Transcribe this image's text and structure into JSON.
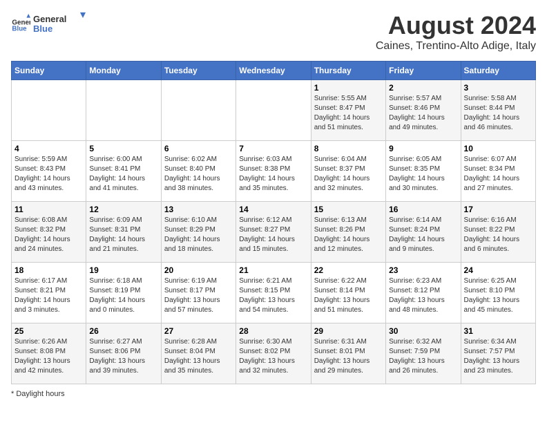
{
  "header": {
    "title": "August 2024",
    "subtitle": "Caines, Trentino-Alto Adige, Italy",
    "logo_line1": "General",
    "logo_line2": "Blue"
  },
  "days_of_week": [
    "Sunday",
    "Monday",
    "Tuesday",
    "Wednesday",
    "Thursday",
    "Friday",
    "Saturday"
  ],
  "weeks": [
    [
      {
        "day": "",
        "info": ""
      },
      {
        "day": "",
        "info": ""
      },
      {
        "day": "",
        "info": ""
      },
      {
        "day": "",
        "info": ""
      },
      {
        "day": "1",
        "info": "Sunrise: 5:55 AM\nSunset: 8:47 PM\nDaylight: 14 hours and 51 minutes."
      },
      {
        "day": "2",
        "info": "Sunrise: 5:57 AM\nSunset: 8:46 PM\nDaylight: 14 hours and 49 minutes."
      },
      {
        "day": "3",
        "info": "Sunrise: 5:58 AM\nSunset: 8:44 PM\nDaylight: 14 hours and 46 minutes."
      }
    ],
    [
      {
        "day": "4",
        "info": "Sunrise: 5:59 AM\nSunset: 8:43 PM\nDaylight: 14 hours and 43 minutes."
      },
      {
        "day": "5",
        "info": "Sunrise: 6:00 AM\nSunset: 8:41 PM\nDaylight: 14 hours and 41 minutes."
      },
      {
        "day": "6",
        "info": "Sunrise: 6:02 AM\nSunset: 8:40 PM\nDaylight: 14 hours and 38 minutes."
      },
      {
        "day": "7",
        "info": "Sunrise: 6:03 AM\nSunset: 8:38 PM\nDaylight: 14 hours and 35 minutes."
      },
      {
        "day": "8",
        "info": "Sunrise: 6:04 AM\nSunset: 8:37 PM\nDaylight: 14 hours and 32 minutes."
      },
      {
        "day": "9",
        "info": "Sunrise: 6:05 AM\nSunset: 8:35 PM\nDaylight: 14 hours and 30 minutes."
      },
      {
        "day": "10",
        "info": "Sunrise: 6:07 AM\nSunset: 8:34 PM\nDaylight: 14 hours and 27 minutes."
      }
    ],
    [
      {
        "day": "11",
        "info": "Sunrise: 6:08 AM\nSunset: 8:32 PM\nDaylight: 14 hours and 24 minutes."
      },
      {
        "day": "12",
        "info": "Sunrise: 6:09 AM\nSunset: 8:31 PM\nDaylight: 14 hours and 21 minutes."
      },
      {
        "day": "13",
        "info": "Sunrise: 6:10 AM\nSunset: 8:29 PM\nDaylight: 14 hours and 18 minutes."
      },
      {
        "day": "14",
        "info": "Sunrise: 6:12 AM\nSunset: 8:27 PM\nDaylight: 14 hours and 15 minutes."
      },
      {
        "day": "15",
        "info": "Sunrise: 6:13 AM\nSunset: 8:26 PM\nDaylight: 14 hours and 12 minutes."
      },
      {
        "day": "16",
        "info": "Sunrise: 6:14 AM\nSunset: 8:24 PM\nDaylight: 14 hours and 9 minutes."
      },
      {
        "day": "17",
        "info": "Sunrise: 6:16 AM\nSunset: 8:22 PM\nDaylight: 14 hours and 6 minutes."
      }
    ],
    [
      {
        "day": "18",
        "info": "Sunrise: 6:17 AM\nSunset: 8:21 PM\nDaylight: 14 hours and 3 minutes."
      },
      {
        "day": "19",
        "info": "Sunrise: 6:18 AM\nSunset: 8:19 PM\nDaylight: 14 hours and 0 minutes."
      },
      {
        "day": "20",
        "info": "Sunrise: 6:19 AM\nSunset: 8:17 PM\nDaylight: 13 hours and 57 minutes."
      },
      {
        "day": "21",
        "info": "Sunrise: 6:21 AM\nSunset: 8:15 PM\nDaylight: 13 hours and 54 minutes."
      },
      {
        "day": "22",
        "info": "Sunrise: 6:22 AM\nSunset: 8:14 PM\nDaylight: 13 hours and 51 minutes."
      },
      {
        "day": "23",
        "info": "Sunrise: 6:23 AM\nSunset: 8:12 PM\nDaylight: 13 hours and 48 minutes."
      },
      {
        "day": "24",
        "info": "Sunrise: 6:25 AM\nSunset: 8:10 PM\nDaylight: 13 hours and 45 minutes."
      }
    ],
    [
      {
        "day": "25",
        "info": "Sunrise: 6:26 AM\nSunset: 8:08 PM\nDaylight: 13 hours and 42 minutes."
      },
      {
        "day": "26",
        "info": "Sunrise: 6:27 AM\nSunset: 8:06 PM\nDaylight: 13 hours and 39 minutes."
      },
      {
        "day": "27",
        "info": "Sunrise: 6:28 AM\nSunset: 8:04 PM\nDaylight: 13 hours and 35 minutes."
      },
      {
        "day": "28",
        "info": "Sunrise: 6:30 AM\nSunset: 8:02 PM\nDaylight: 13 hours and 32 minutes."
      },
      {
        "day": "29",
        "info": "Sunrise: 6:31 AM\nSunset: 8:01 PM\nDaylight: 13 hours and 29 minutes."
      },
      {
        "day": "30",
        "info": "Sunrise: 6:32 AM\nSunset: 7:59 PM\nDaylight: 13 hours and 26 minutes."
      },
      {
        "day": "31",
        "info": "Sunrise: 6:34 AM\nSunset: 7:57 PM\nDaylight: 13 hours and 23 minutes."
      }
    ]
  ],
  "footer": {
    "note": "Daylight hours"
  }
}
